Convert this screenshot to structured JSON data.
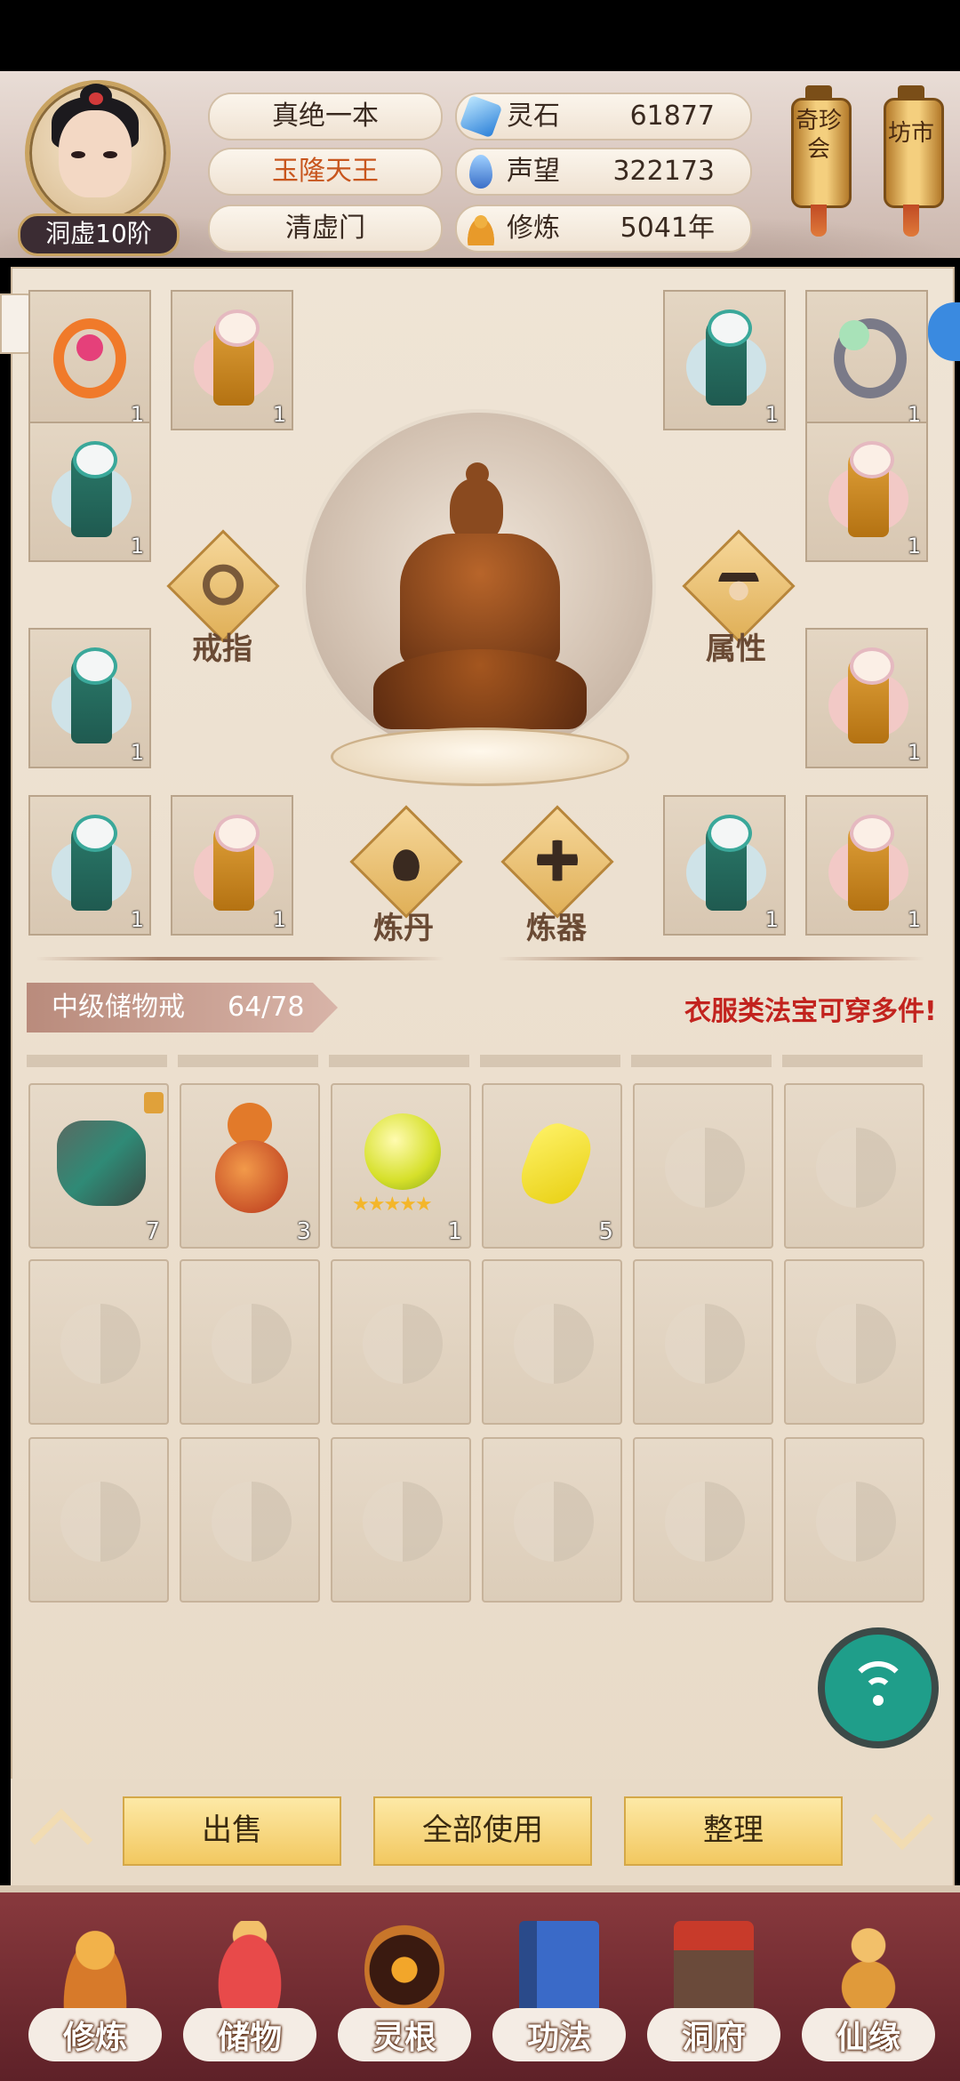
{
  "player": {
    "rank_label": "洞虚10阶",
    "name": "真绝一本",
    "title": "玉隆天王",
    "sect": "清虚门"
  },
  "stats": [
    {
      "label": "灵石",
      "value": "61877",
      "icon": "spirit-stone-icon"
    },
    {
      "label": "声望",
      "value": "322173",
      "icon": "prestige-icon"
    },
    {
      "label": "修炼",
      "value": "5041年",
      "icon": "cultivation-icon"
    }
  ],
  "lanterns": [
    {
      "label": "奇珍会"
    },
    {
      "label": "坊市"
    }
  ],
  "equipment": {
    "ring_label": "戒指",
    "attr_label": "属性",
    "alchemy_label": "炼丹",
    "forge_label": "炼器",
    "slots": [
      {
        "item": "ring-orange",
        "count": "1"
      },
      {
        "item": "robe-gold",
        "count": "1"
      },
      {
        "item": "robe-teal",
        "count": "1"
      },
      {
        "item": "ring-silver",
        "count": "1"
      },
      {
        "item": "robe-teal",
        "count": "1"
      },
      {
        "item": "robe-gold",
        "count": "1"
      },
      {
        "item": "robe-teal",
        "count": "1"
      },
      {
        "item": "robe-gold",
        "count": "1"
      },
      {
        "item": "robe-teal",
        "count": "1"
      },
      {
        "item": "robe-gold",
        "count": "1"
      },
      {
        "item": "robe-teal",
        "count": "1"
      },
      {
        "item": "robe-gold",
        "count": "1"
      }
    ]
  },
  "storage": {
    "name": "中级储物戒",
    "capacity": "64/78",
    "hint": "衣服类法宝可穿多件!",
    "items": [
      {
        "item": "ore",
        "count": "7"
      },
      {
        "item": "gourd",
        "count": "3"
      },
      {
        "item": "orb",
        "count": "1"
      },
      {
        "item": "gold-nugget",
        "count": "5"
      },
      {
        "item": "empty",
        "count": ""
      },
      {
        "item": "empty",
        "count": ""
      }
    ]
  },
  "actions": {
    "sell": "出售",
    "use_all": "全部使用",
    "sort": "整理"
  },
  "nav": [
    {
      "label": "修炼"
    },
    {
      "label": "储物"
    },
    {
      "label": "灵根"
    },
    {
      "label": "功法"
    },
    {
      "label": "洞府"
    },
    {
      "label": "仙缘"
    }
  ],
  "colors": {
    "title_orange": "#c8561e",
    "hint_red": "#c2231e",
    "nav_bg": "#6e2a30"
  }
}
